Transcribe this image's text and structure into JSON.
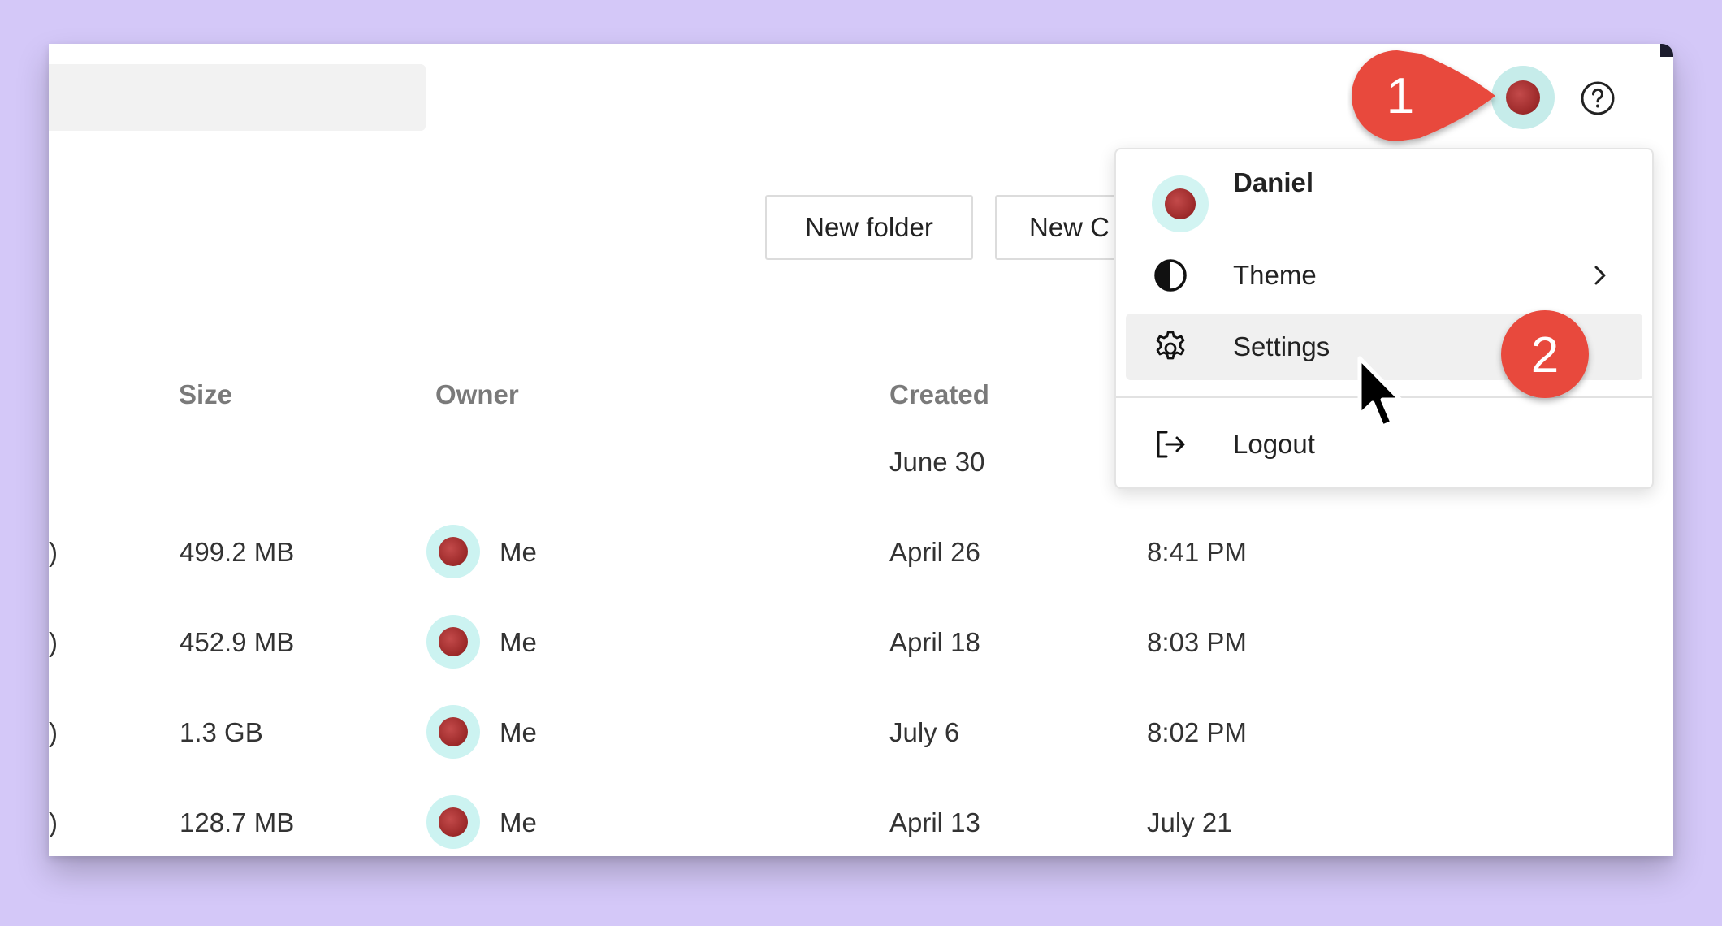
{
  "toolbar": {
    "new_folder_label": "New folder",
    "new_other_label": "New C"
  },
  "table": {
    "headers": [
      "Size",
      "Owner",
      "Created"
    ],
    "rows": [
      {
        "paren": "",
        "size": "",
        "owner": "",
        "created": "June 30",
        "time": ""
      },
      {
        "paren": ")",
        "size": "499.2 MB",
        "owner": "Me",
        "created": "April 26",
        "time": "8:41 PM"
      },
      {
        "paren": ")",
        "size": "452.9 MB",
        "owner": "Me",
        "created": "April 18",
        "time": "8:03 PM"
      },
      {
        "paren": ")",
        "size": "1.3 GB",
        "owner": "Me",
        "created": "July 6",
        "time": "8:02 PM"
      },
      {
        "paren": ")",
        "size": "128.7 MB",
        "owner": "Me",
        "created": "April 13",
        "time": "July 21"
      }
    ]
  },
  "user_menu": {
    "user_name": "Daniel",
    "items": [
      {
        "label": "Theme",
        "icon": "half-circle-icon"
      },
      {
        "label": "Settings",
        "icon": "gear-icon"
      },
      {
        "label": "Logout",
        "icon": "logout-icon"
      }
    ]
  },
  "callouts": {
    "step1": "1",
    "step2": "2"
  },
  "colors": {
    "background": "#d4c8f8",
    "callout": "#e8483c",
    "avatar": "#9a2828",
    "avatar_ring": "#c6ecea"
  }
}
